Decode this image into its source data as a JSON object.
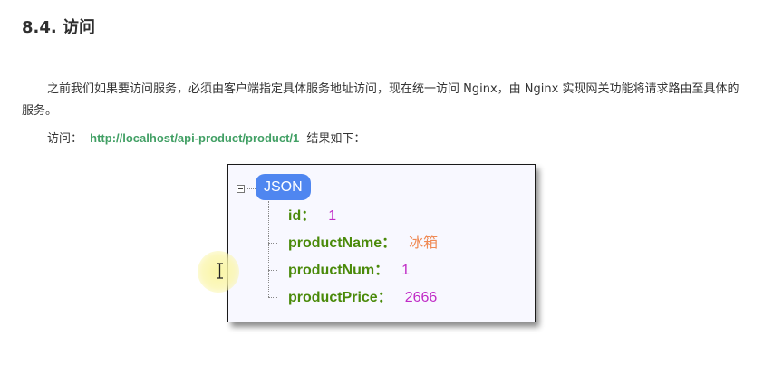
{
  "section": {
    "heading": "8.4. 访问",
    "paragraph": "之前我们如果要访问服务，必须由客户端指定具体服务地址访问，现在统一访问 Nginx，由 Nginx 实现网关功能将请求路由至具体的服务。",
    "visit_prefix": "访问：",
    "visit_url": "http://localhost/api-product/product/1",
    "visit_suffix": "结果如下："
  },
  "json_view": {
    "root_label": "JSON",
    "fields": [
      {
        "key": "id：",
        "value": "1",
        "type": "number"
      },
      {
        "key": "productName：",
        "value": "冰箱",
        "type": "string"
      },
      {
        "key": "productNum：",
        "value": "1",
        "type": "number"
      },
      {
        "key": "productPrice：",
        "value": "2666",
        "type": "number"
      }
    ]
  },
  "colors": {
    "link": "#42a065",
    "json_key": "#4a8a0a",
    "json_number": "#c02bc6",
    "json_string": "#ef8a55",
    "root_pill": "#4f86f0"
  },
  "icons": {
    "collapse": "collapse-minus-icon",
    "cursor": "text-ibeam-cursor-icon"
  }
}
